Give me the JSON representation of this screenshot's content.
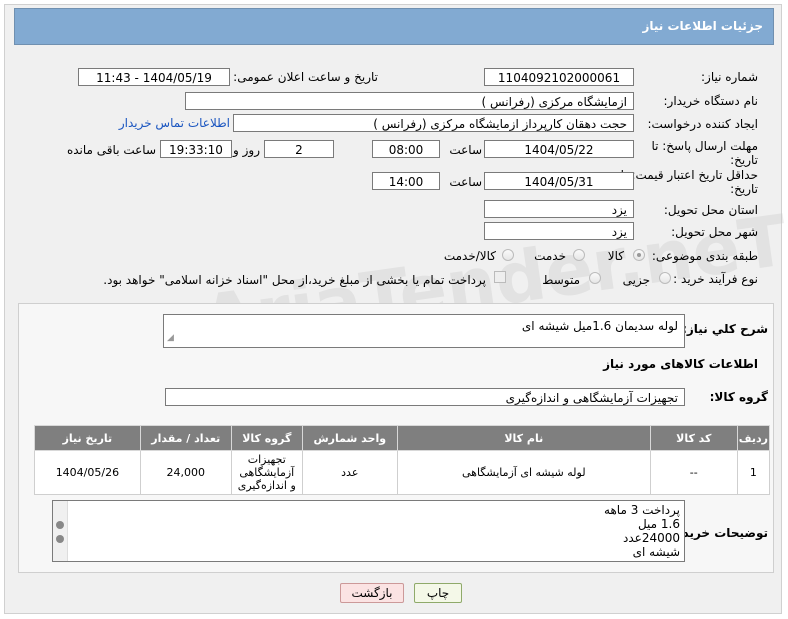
{
  "header": {
    "title": "جزئیات اطلاعات نیاز"
  },
  "fields": {
    "need_number_label": "شماره نیاز:",
    "need_number": "1104092102000061",
    "announce_label": "تاریخ و ساعت اعلان عمومی:",
    "announce_value": "1404/05/19 - 11:43",
    "buyer_org_label": "نام دستگاه خریدار:",
    "buyer_org": "ازمایشگاه مرکزی (رفرانس )",
    "creator_label": "ایجاد کننده درخواست:",
    "creator": "حجت دهقان کارپرداز ازمایشگاه مرکزی (رفرانس )",
    "contact_link": "اطلاعات تماس خریدار",
    "deadline_label": "مهلت ارسال پاسخ: تا تاریخ:",
    "deadline_date": "1404/05/22",
    "time_label": "ساعت",
    "deadline_time": "08:00",
    "days_value": "2",
    "days_label": "روز و",
    "remaining_time": "19:33:10",
    "remaining_label": "ساعت باقی مانده",
    "price_validity_label": "حداقل تاریخ اعتبار قیمت: تا تاریخ:",
    "price_validity_date": "1404/05/31",
    "price_validity_time": "14:00",
    "province_label": "استان محل تحویل:",
    "province": "یزد",
    "city_label": "شهر محل تحویل:",
    "city": "یزد",
    "category_label": "طبقه بندی موضوعی:",
    "category_options": [
      "کالا",
      "خدمت",
      "کالا/خدمت"
    ],
    "process_label": "نوع فرآیند خرید :",
    "process_options": [
      "جزیی",
      "متوسط"
    ],
    "payment_note": "پرداخت تمام یا بخشی از مبلغ خرید،از محل \"اسناد خزانه اسلامی\" خواهد بود."
  },
  "description": {
    "label": "شرح کلي نياز:",
    "value": "لوله سدیمان 1.6میل شیشه ای"
  },
  "goods": {
    "section_title": "اطلاعات کالاهای مورد نیاز",
    "group_label": "گروه کالا:",
    "group_value": "تجهیزات آزمایشگاهی و اندازه‌گیری",
    "columns": [
      "ردیف",
      "کد کالا",
      "نام کالا",
      "واحد شمارش",
      "گروه کالا",
      "تعداد / مقدار",
      "تاریخ نیاز"
    ],
    "rows": [
      {
        "row": "1",
        "code": "--",
        "name": "لوله شیشه ای آزمایشگاهی",
        "unit": "عدد",
        "group": "تجهیزات آزمایشگاهی و اندازه‌گیری",
        "qty": "24,000",
        "date": "1404/05/26"
      }
    ]
  },
  "buyer_notes": {
    "label": "توضیحات خریدار:",
    "lines": [
      "پرداخت 3 ماهه",
      "1.6 میل",
      "24000عدد",
      "شیشه ای"
    ]
  },
  "buttons": {
    "print": "چاپ",
    "back": "بازگشت"
  },
  "watermark": "AriaTender.neT"
}
